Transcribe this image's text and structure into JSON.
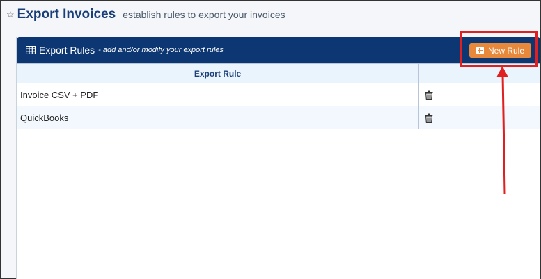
{
  "page": {
    "title": "Export Invoices",
    "subtitle": "establish rules to export your invoices",
    "favorite_icon": "star-outline-icon"
  },
  "panel": {
    "title": "Export Rules",
    "subtitle": "- add and/or modify your export rules",
    "icon": "table-grid-icon",
    "new_rule_label": "New Rule",
    "new_rule_icon": "plus-square-icon"
  },
  "table": {
    "columns": [
      "Export Rule",
      ""
    ],
    "rows": [
      {
        "name": "Invoice CSV + PDF",
        "action_icon": "trash-icon"
      },
      {
        "name": "QuickBooks",
        "action_icon": "trash-icon"
      }
    ]
  },
  "annotation": {
    "highlight_color": "#e02020",
    "target": "new-rule-button"
  },
  "colors": {
    "header_bg": "#0d3772",
    "title": "#1a3e7a",
    "button": "#e8883a",
    "table_header_bg": "#eaf4fc"
  }
}
